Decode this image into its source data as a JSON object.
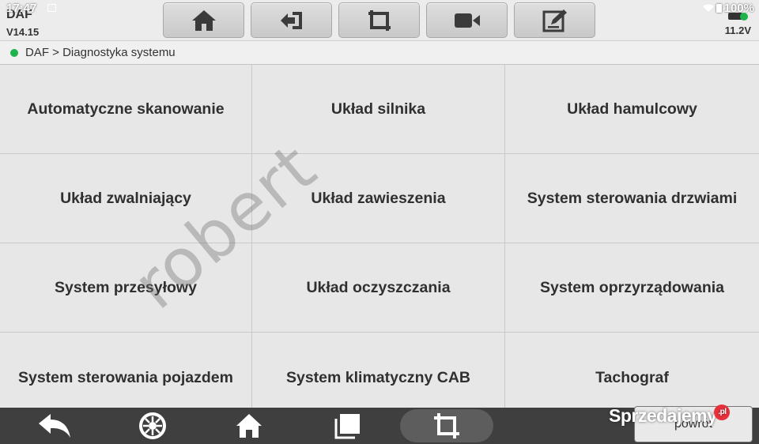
{
  "status_bar": {
    "time": "17:47",
    "battery": "100%"
  },
  "header": {
    "brand": "DAF",
    "version": "V14.15",
    "voltage": "11.2V",
    "toolbar": [
      {
        "icon": "home-icon"
      },
      {
        "icon": "exit-icon"
      },
      {
        "icon": "crop-icon"
      },
      {
        "icon": "video-camera-icon"
      },
      {
        "icon": "edit-icon"
      }
    ]
  },
  "breadcrumb": {
    "text": "DAF > Diagnostyka systemu",
    "status_color": "#1bb34a"
  },
  "systems": [
    "Automatyczne skanowanie",
    "Układ silnika",
    "Układ hamulcowy",
    "Układ zwalniający",
    "Układ zawieszenia",
    "System sterowania drzwiami",
    "System przesyłowy",
    "Układ oczyszczania",
    "System oprzyrządowania",
    "System sterowania pojazdem",
    "System klimatyczny CAB",
    "Tachograf"
  ],
  "watermark": "robert",
  "bottom_nav": {
    "items": [
      "back-arrow-icon",
      "tire-icon",
      "home-icon",
      "windows-icon",
      "crop-icon"
    ],
    "back_label": "powrót"
  },
  "logo": {
    "text": "Sprzedajemy",
    "badge": ".pl"
  }
}
